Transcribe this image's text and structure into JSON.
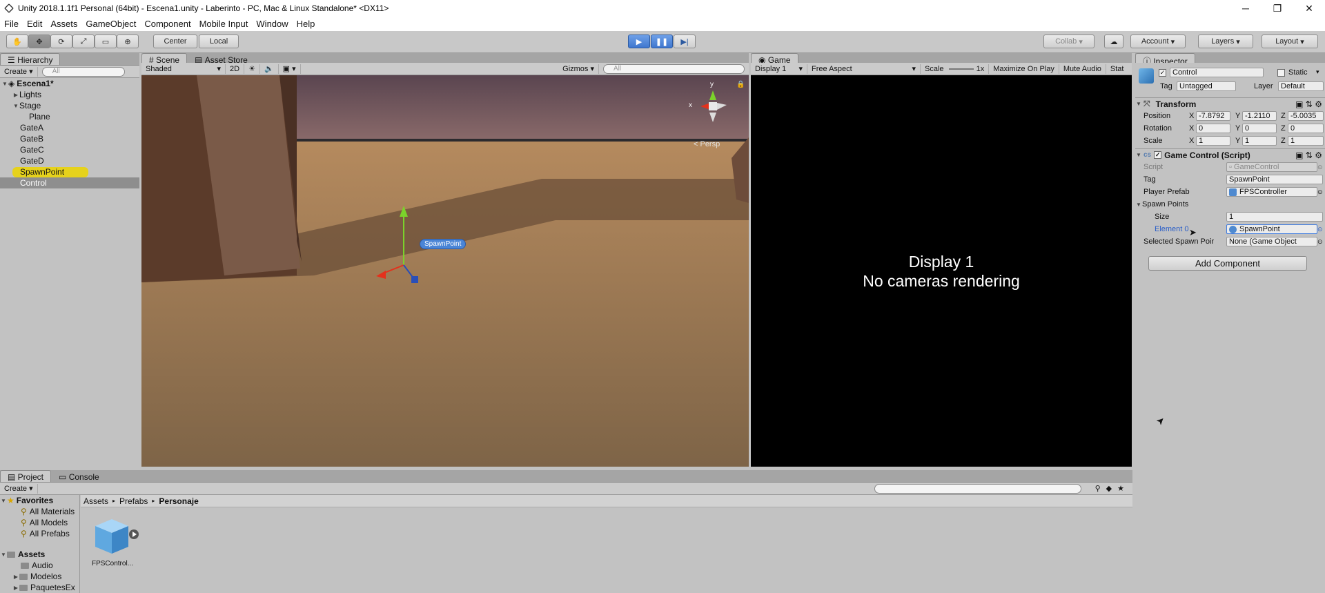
{
  "window": {
    "title": "Unity 2018.1.1f1 Personal (64bit) - Escena1.unity - Laberinto - PC, Mac & Linux Standalone* <DX11>",
    "minimize": "─",
    "maximize": "❐",
    "close": "✕"
  },
  "menu": [
    "File",
    "Edit",
    "Assets",
    "GameObject",
    "Component",
    "Mobile Input",
    "Window",
    "Help"
  ],
  "toolbar": {
    "center": "Center",
    "local": "Local",
    "collab": "Collab",
    "account": "Account",
    "layers": "Layers",
    "layout": "Layout"
  },
  "hierarchy": {
    "tab": "Hierarchy",
    "create": "Create",
    "search": "All",
    "scene": "Escena1*",
    "items": [
      "Lights",
      "Stage",
      "Plane",
      "GateA",
      "GateB",
      "GateC",
      "GateD",
      "SpawnPoint",
      "Control"
    ]
  },
  "scene": {
    "tab": "Scene",
    "tab2": "Asset Store",
    "shaded": "Shaded",
    "twod": "2D",
    "gizmos": "Gizmos",
    "search": "All",
    "persp": "< Persp",
    "spawn_label": "SpawnPoint",
    "axis_y": "y",
    "axis_x": "x"
  },
  "game": {
    "tab": "Game",
    "display": "Display 1",
    "aspect": "Free Aspect",
    "scale": "Scale",
    "scale_val": "1x",
    "maximize": "Maximize On Play",
    "mute": "Mute Audio",
    "stats": "Stat",
    "line1": "Display 1",
    "line2": "No cameras rendering"
  },
  "inspector": {
    "tab": "Inspector",
    "name": "Control",
    "static": "Static",
    "tag_label": "Tag",
    "tag": "Untagged",
    "layer_label": "Layer",
    "layer": "Default",
    "transform": "Transform",
    "position": "Position",
    "rotation": "Rotation",
    "scale": "Scale",
    "pos": [
      "-7.8792",
      "-1.2110",
      "-5.0035"
    ],
    "rot": [
      "0",
      "0",
      "0"
    ],
    "scl": [
      "1",
      "1",
      "1"
    ],
    "script_comp": "Game Control (Script)",
    "script_label": "Script",
    "script_val": "GameControl",
    "tag2_label": "Tag",
    "tag2_val": "SpawnPoint",
    "prefab_label": "Player Prefab",
    "prefab_val": "FPSController",
    "spawn_points": "Spawn Points",
    "size_label": "Size",
    "size_val": "1",
    "element_label": "Element 0",
    "element_val": "SpawnPoint",
    "selected_label": "Selected Spawn Poir",
    "selected_val": "None (Game Object",
    "add_component": "Add Component"
  },
  "project": {
    "tab": "Project",
    "tab2": "Console",
    "create": "Create",
    "favorites": "Favorites",
    "fav_items": [
      "All Materials",
      "All Models",
      "All Prefabs"
    ],
    "assets": "Assets",
    "asset_folders": [
      "Audio",
      "Modelos",
      "PaquetesEx"
    ],
    "breadcrumb": [
      "Assets",
      "Prefabs",
      "Personaje"
    ],
    "file": "FPSControl..."
  }
}
